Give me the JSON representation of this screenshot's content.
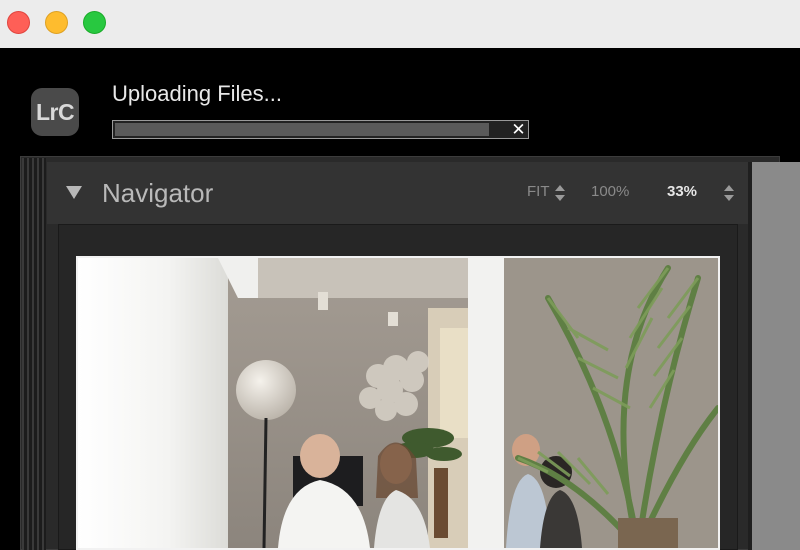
{
  "window": {
    "traffic_lights": [
      "close",
      "minimize",
      "zoom"
    ],
    "colors": {
      "close": "#fe5f57",
      "minimize": "#febc2e",
      "zoom": "#28c840"
    }
  },
  "app": {
    "logo_text": "LrC",
    "upload": {
      "title": "Uploading Files...",
      "progress": 0.95,
      "cancel_icon": "close-icon"
    }
  },
  "navigator": {
    "title": "Navigator",
    "zoom_options": {
      "fit": "FIT",
      "full": "100%",
      "custom": "33%"
    },
    "selected_zoom": "33%"
  },
  "preview": {
    "icon": "photo-preview"
  }
}
